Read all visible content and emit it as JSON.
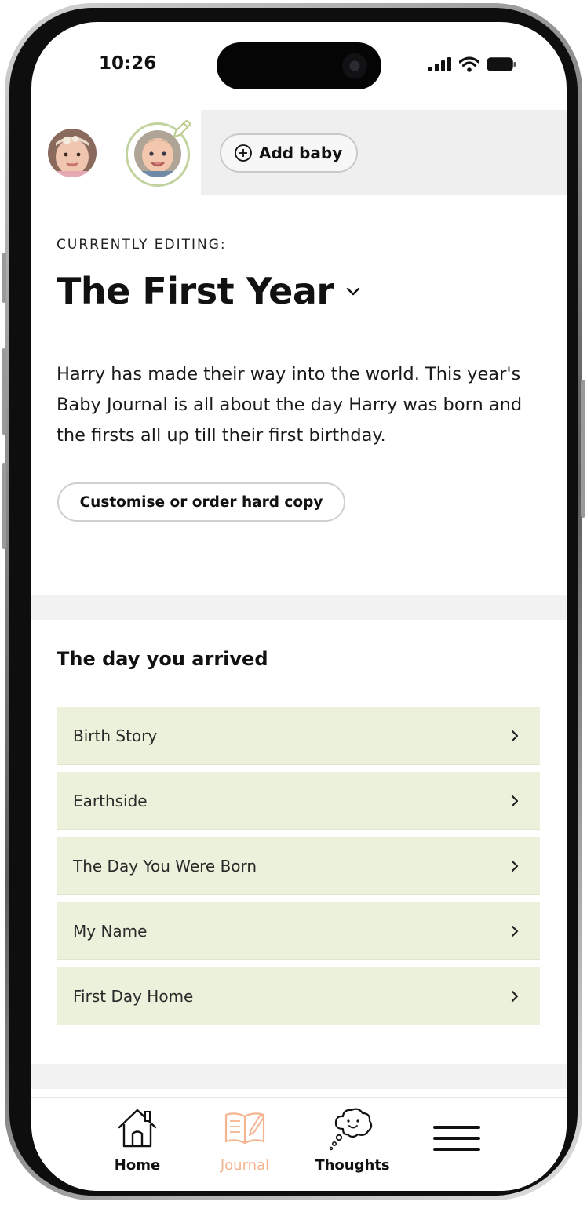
{
  "status_bar": {
    "time": "10:26"
  },
  "baby_selector": {
    "add_baby_label": "Add baby",
    "ring_color": "#c3d39f"
  },
  "journal": {
    "editing_label": "CURRENTLY EDITING:",
    "title": "The First Year",
    "description": "Harry has made their way into the world. This year's Baby Journal is all about the day Harry was born and the firsts all up till their first birthday.",
    "hardcopy_button": "Customise or order hard copy"
  },
  "section": {
    "title": "The day you arrived",
    "items": [
      {
        "label": "Birth Story"
      },
      {
        "label": "Earthside"
      },
      {
        "label": "The Day You Were Born"
      },
      {
        "label": "My Name"
      },
      {
        "label": "First Day Home"
      }
    ],
    "item_bg_color": "#ebf1da"
  },
  "bottom_nav": {
    "items": [
      {
        "label": "Home",
        "icon": "house-icon",
        "active": false
      },
      {
        "label": "Journal",
        "icon": "open-book-icon",
        "active": true
      },
      {
        "label": "Thoughts",
        "icon": "thought-cloud-icon",
        "active": false
      }
    ],
    "menu_icon": "hamburger-menu-icon",
    "active_color": "#f4b48f"
  }
}
